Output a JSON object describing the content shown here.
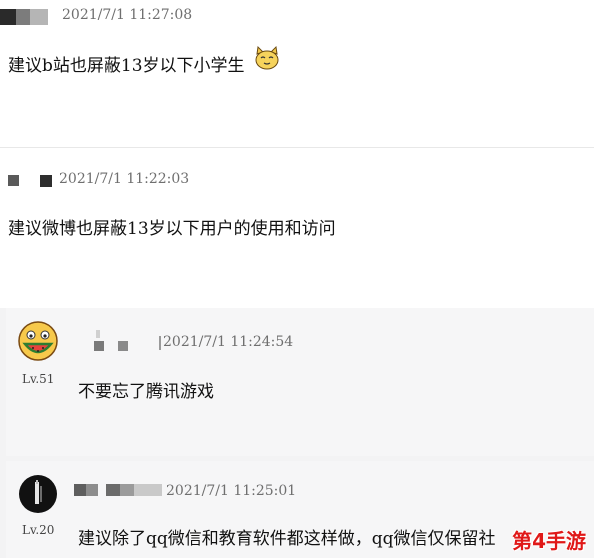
{
  "comments": [
    {
      "time": "2021/7/1 11:27:08",
      "text": "建议b站也屏蔽13岁以下小学生",
      "emoji": "cat-face-emoji"
    },
    {
      "time": "2021/7/1 11:22:03",
      "text": "建议微博也屏蔽13岁以下用户的使用和访问"
    }
  ],
  "replies": [
    {
      "time": "2021/7/1 11:24:54",
      "level": "Lv.51",
      "text": "不要忘了腾讯游戏",
      "avatar": "watermelon-face-avatar"
    },
    {
      "time": "2021/7/1 11:25:01",
      "level": "Lv.20",
      "text": "建议除了qq微信和教育软件都这样做，qq微信仅保留社",
      "avatar": "dark-figure-avatar"
    }
  ],
  "watermark": "第4手游",
  "colors": {
    "watermark": "#e01818",
    "timestamp": "#6f6f6f",
    "reply_background": "#f3f3f4"
  }
}
